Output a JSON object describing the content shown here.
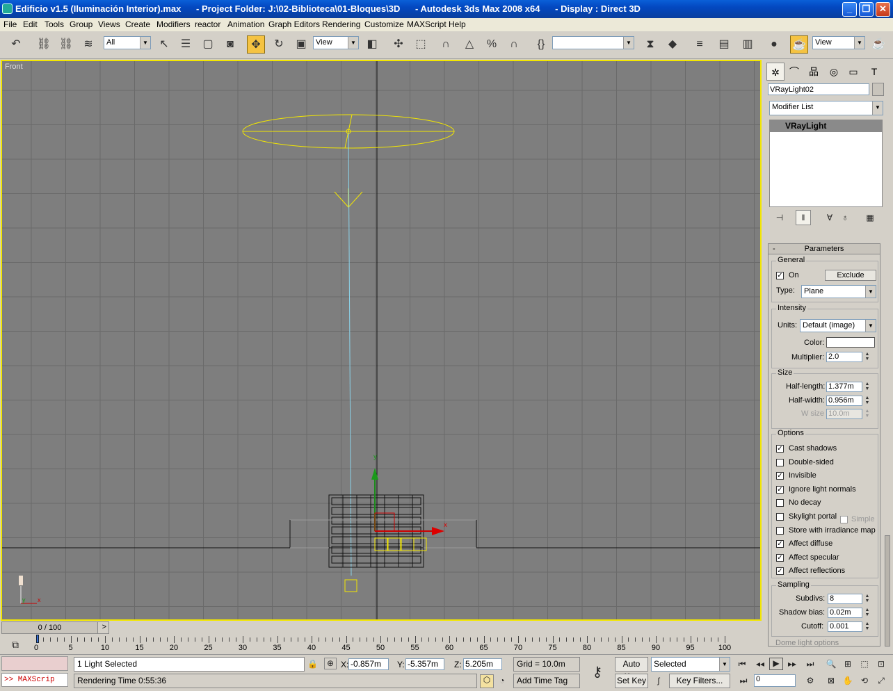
{
  "window": {
    "title": "Edificio v1.5 (Iluminación Interior).max      - Project Folder: J:\\02-Biblioteca\\01-Bloques\\3D      - Autodesk 3ds Max 2008 x64      - Display : Direct 3D",
    "minimize": "_",
    "maximize": "❐",
    "close": "✕"
  },
  "menu": [
    "File",
    "Edit",
    "Tools",
    "Group",
    "Views",
    "Create",
    "Modifiers",
    "reactor",
    "Animation",
    "Graph Editors",
    "Rendering",
    "Customize",
    "MAXScript",
    "Help"
  ],
  "toolbar": {
    "selection_filter": "All",
    "ref_coord": "View",
    "named_sel": "",
    "view_dropdown": "View"
  },
  "viewport": {
    "label": "Front",
    "gizmo": {
      "x_label": "x",
      "y_label": "y"
    },
    "axis_tripod": {
      "x_label": "x",
      "y_label": "y"
    }
  },
  "command_panel": {
    "object_name": "VRayLight02",
    "modifier_list": "Modifier List",
    "stack_item": "VRayLight",
    "rollout_title": "Parameters",
    "rollout_collapse": "-",
    "general": {
      "legend": "General",
      "on_label": "On",
      "on_checked": true,
      "exclude_button": "Exclude",
      "type_label": "Type:",
      "type_value": "Plane"
    },
    "intensity": {
      "legend": "Intensity",
      "units_label": "Units:",
      "units_value": "Default (image)",
      "color_label": "Color:",
      "color_value": "#ffffff",
      "multiplier_label": "Multiplier:",
      "multiplier_value": "2.0"
    },
    "size": {
      "legend": "Size",
      "half_length_label": "Half-length:",
      "half_length_value": "1.377m",
      "half_width_label": "Half-width:",
      "half_width_value": "0.956m",
      "w_size_label": "W size",
      "w_size_value": "10.0m"
    },
    "options": {
      "legend": "Options",
      "items": [
        {
          "label": "Cast shadows",
          "checked": true
        },
        {
          "label": "Double-sided",
          "checked": false
        },
        {
          "label": "Invisible",
          "checked": true
        },
        {
          "label": "Ignore light normals",
          "checked": true
        },
        {
          "label": "No decay",
          "checked": false
        },
        {
          "label": "Skylight portal",
          "checked": false
        },
        {
          "label": "Store with irradiance map",
          "checked": false
        },
        {
          "label": "Affect diffuse",
          "checked": true
        },
        {
          "label": "Affect specular",
          "checked": true
        },
        {
          "label": "Affect reflections",
          "checked": true
        }
      ],
      "simple_label": "Simple",
      "simple_checked": false
    },
    "sampling": {
      "legend": "Sampling",
      "subdivs_label": "Subdivs:",
      "subdivs_value": "8",
      "shadow_bias_label": "Shadow bias:",
      "shadow_bias_value": "0.02m",
      "cutoff_label": "Cutoff:",
      "cutoff_value": "0.001"
    },
    "dome_legend": "Dome light options"
  },
  "timeline": {
    "slider_label": "0 / 100",
    "prev": "<",
    "next": ">",
    "ticks": [
      "0",
      "5",
      "10",
      "15",
      "20",
      "25",
      "30",
      "35",
      "40",
      "45",
      "50",
      "55",
      "60",
      "65",
      "70",
      "75",
      "80",
      "85",
      "90",
      "95",
      "100"
    ]
  },
  "status": {
    "maxscript_label": ">> MAXScrip",
    "selection_info": "1 Light Selected",
    "prompt": "Rendering Time  0:55:36",
    "x_label": "X:",
    "x_value": "-0.857m",
    "y_label": "Y:",
    "y_value": "-5.357m",
    "z_label": "Z:",
    "z_value": "5.205m",
    "grid": "Grid = 10.0m",
    "add_time_tag": "Add Time Tag",
    "auto_key": "Auto Key",
    "set_key": "Set Key",
    "key_mode": "Selected",
    "key_filters": "Key Filters...",
    "frame_value": "0"
  }
}
